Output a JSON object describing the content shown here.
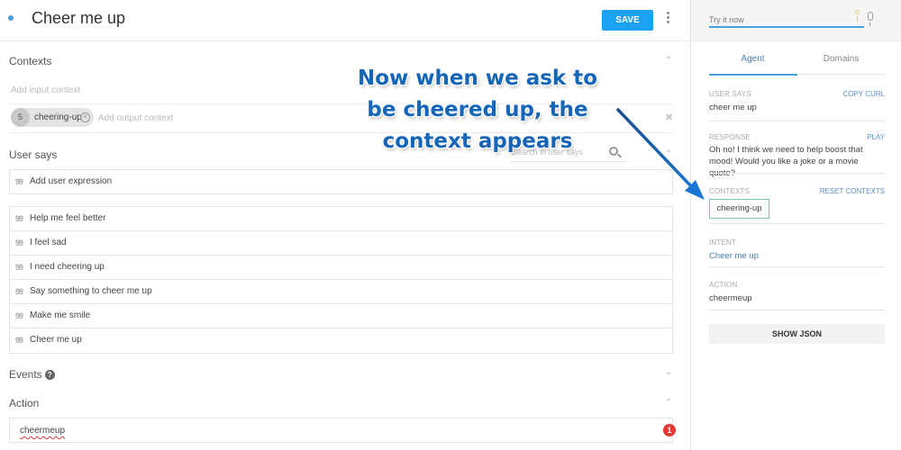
{
  "header": {
    "title": "Cheer me up",
    "save_label": "SAVE"
  },
  "contexts": {
    "label": "Contexts",
    "input_placeholder": "Add input context",
    "output_chip": {
      "lifespan": "5",
      "name": "cheering-up"
    },
    "output_placeholder": "Add output context"
  },
  "user_says": {
    "label": "User says",
    "search_placeholder": "Search in user says",
    "add_placeholder": "Add user expression",
    "quote_glyph": "99",
    "expressions": [
      "Help me feel better",
      "I feel sad",
      "I need cheering up",
      "Say something to cheer me up",
      "Make me smile",
      "Cheer me up"
    ]
  },
  "events": {
    "label": "Events",
    "help_glyph": "?"
  },
  "action": {
    "label": "Action",
    "value": "cheermeup",
    "error_count": "1"
  },
  "side": {
    "try_placeholder": "Try it now",
    "tabs": [
      {
        "label": "Agent",
        "active": true
      },
      {
        "label": "Domains",
        "active": false
      }
    ],
    "user_says_label": "USER SAYS",
    "copy_curl": "COPY CURL",
    "user_says_value": "cheer me up",
    "response_label": "RESPONSE",
    "play": "PLAY",
    "response_value": "Oh no! I think we need to help boost that mood! Would you like a joke or a movie quote?",
    "contexts_label": "CONTEXTS",
    "reset_contexts": "RESET CONTEXTS",
    "context_chip": "cheering-up",
    "intent_label": "INTENT",
    "intent_value": "Cheer me up",
    "action_label": "ACTION",
    "action_value": "cheermeup",
    "show_json": "SHOW JSON"
  },
  "annotation": {
    "line1": "Now when we ask to",
    "line2": "be cheered up, the",
    "line3": "context appears",
    "color": "#1565b8"
  }
}
